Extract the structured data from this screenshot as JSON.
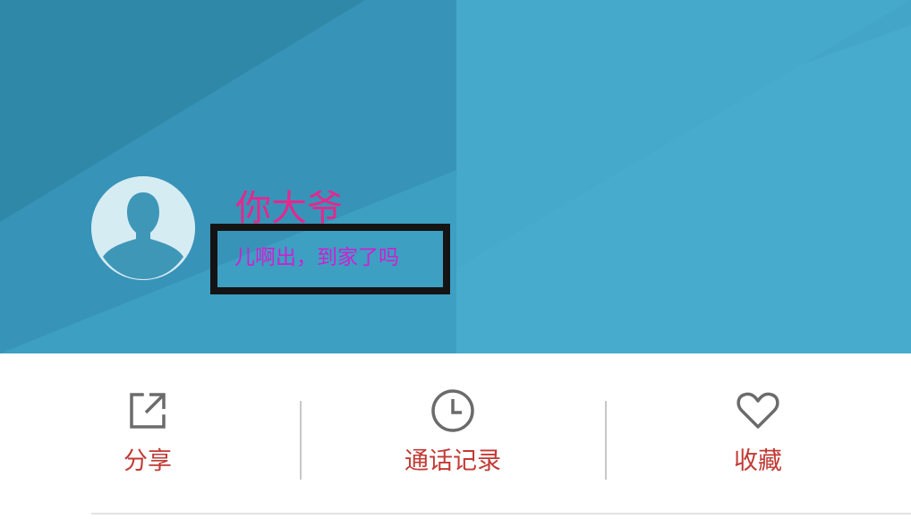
{
  "profile": {
    "name": "你大爷",
    "status": "儿啊出，到家了吗"
  },
  "actions": [
    {
      "label": "分享",
      "icon": "share-icon"
    },
    {
      "label": "通话记录",
      "icon": "clock-icon"
    },
    {
      "label": "收藏",
      "icon": "heart-icon"
    }
  ],
  "colors": {
    "header_bg": "#47abcd",
    "name": "#e3288e",
    "status": "#cf1fd1",
    "action_label": "#c23a34",
    "icon": "#6b6b6b"
  }
}
